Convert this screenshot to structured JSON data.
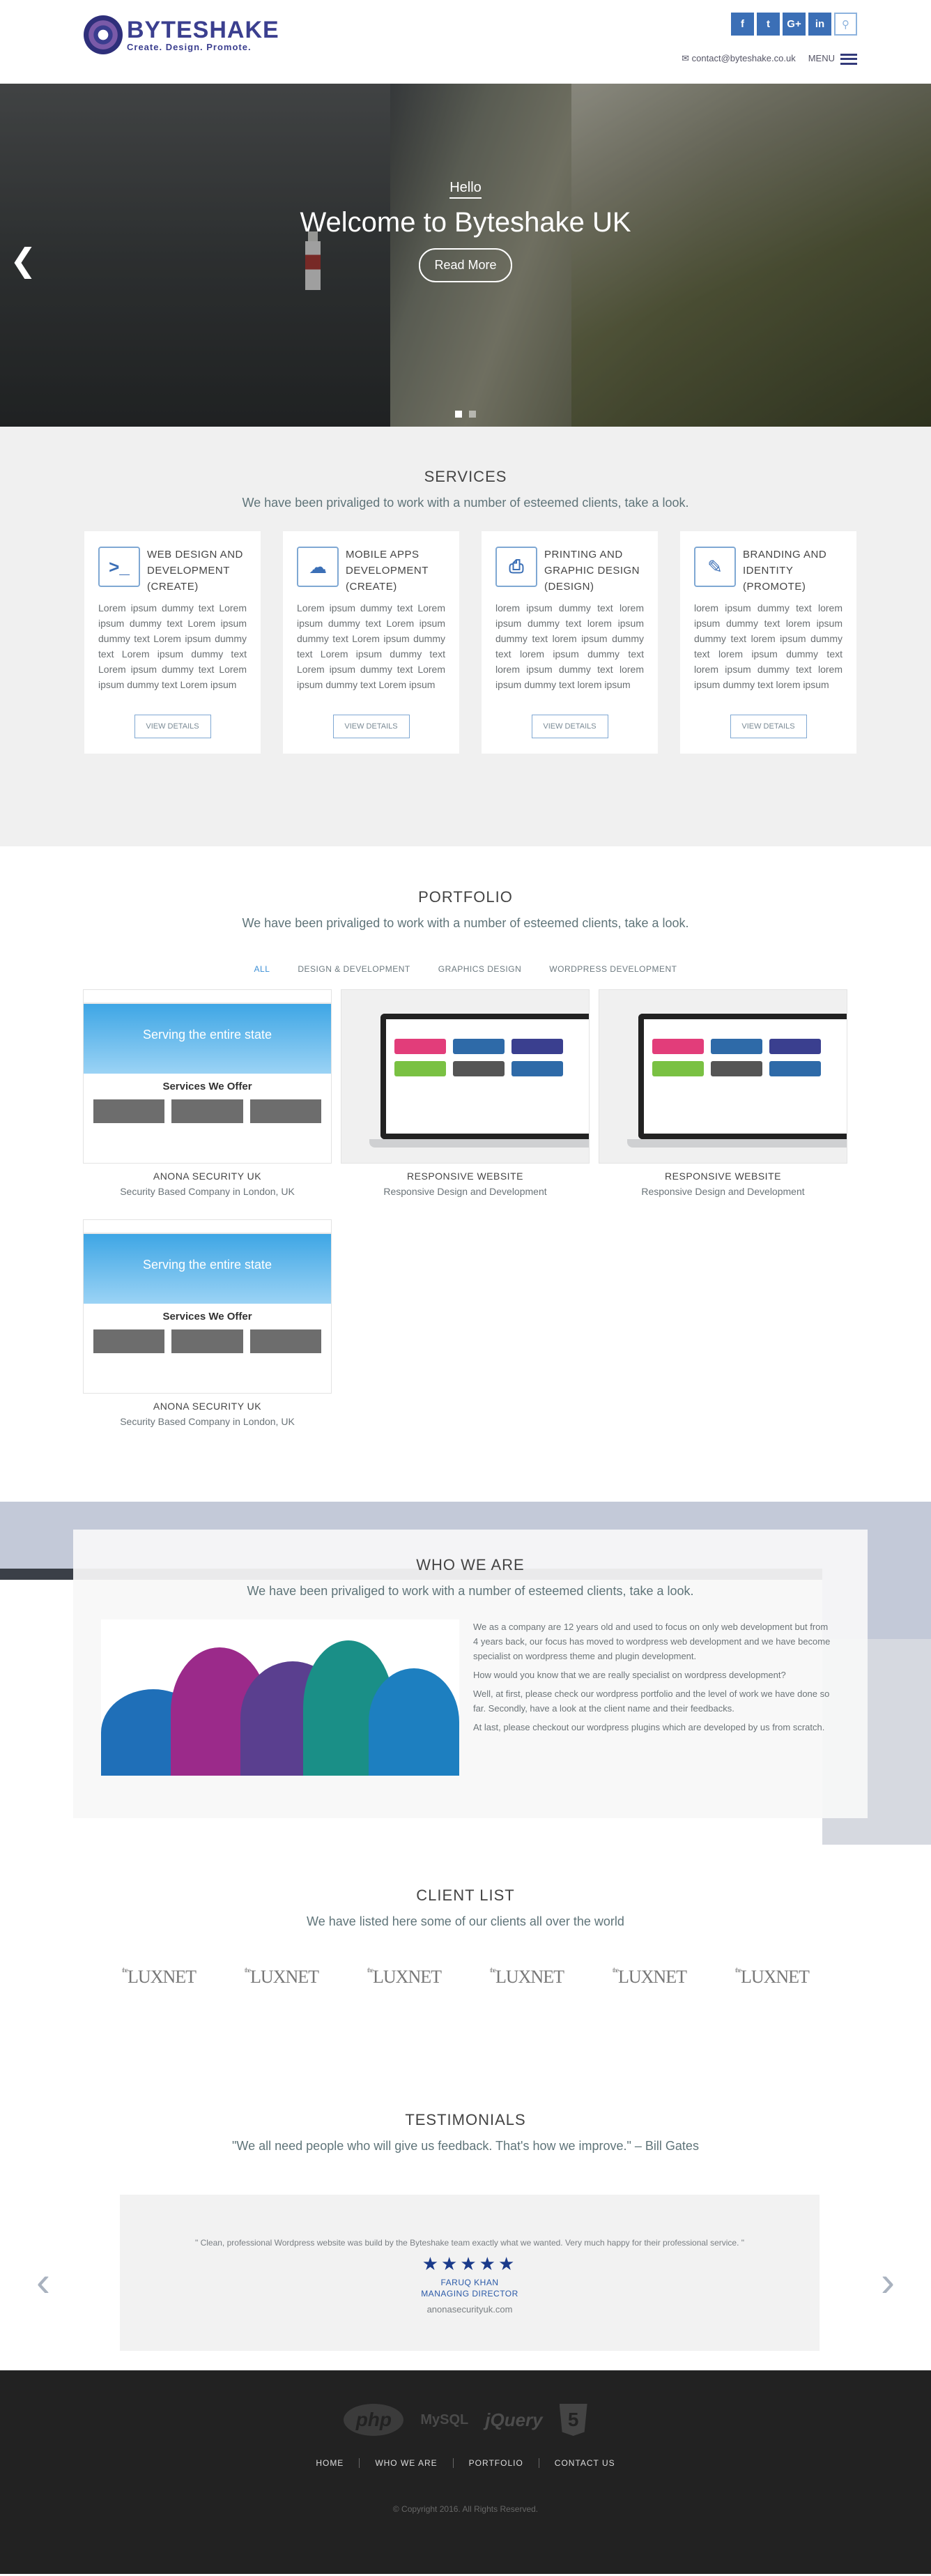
{
  "header": {
    "logo_name": "BYTESHAKE",
    "logo_tag": "Create.  Design.  Promote.",
    "social": [
      "f",
      "t",
      "G+",
      "in"
    ],
    "email": "contact@byteshake.co.uk",
    "menu_label": "MENU"
  },
  "hero": {
    "hello": "Hello",
    "title": "Welcome to Byteshake UK",
    "button": "Read More"
  },
  "services": {
    "title": "SERVICES",
    "subtitle": "We have been privaliged to work with a number of esteemed clients, take a look.",
    "items": [
      {
        "title": "WEB DESIGN AND DEVELOPMENT (CREATE)",
        "text": "Lorem ipsum dummy text Lorem ipsum dummy text Lorem ipsum dummy text Lorem ipsum dummy text Lorem ipsum dummy text Lorem ipsum dummy text Lorem ipsum dummy text Lorem ipsum",
        "button": "VIEW DETAILS",
        "icon": "browser-icon"
      },
      {
        "title": "MOBILE APPS DEVELOPMENT (CREATE)",
        "text": "Lorem ipsum dummy text Lorem ipsum dummy text Lorem ipsum dummy text Lorem ipsum dummy text Lorem ipsum dummy text Lorem ipsum dummy text Lorem ipsum dummy text Lorem ipsum",
        "button": "VIEW DETAILS",
        "icon": "cloud-icon"
      },
      {
        "title": "PRINTING AND GRAPHIC DESIGN (DESIGN)",
        "text": "lorem ipsum dummy text lorem ipsum dummy text lorem ipsum dummy text lorem ipsum dummy text lorem ipsum dummy text lorem ipsum dummy text lorem ipsum dummy text lorem ipsum",
        "button": "VIEW DETAILS",
        "icon": "printer-icon"
      },
      {
        "title": "BRANDING AND IDENTITY (PROMOTE)",
        "text": "lorem ipsum dummy text lorem ipsum dummy text lorem ipsum dummy text lorem ipsum dummy text lorem ipsum dummy text lorem ipsum dummy text lorem ipsum dummy text lorem ipsum",
        "button": "VIEW DETAILS",
        "icon": "pencil-icon"
      }
    ]
  },
  "portfolio": {
    "title": "PORTFOLIO",
    "subtitle": "We have been privaliged to work with a number of esteemed clients, take a look.",
    "tabs": [
      "ALL",
      "DESIGN & DEVELOPMENT",
      "GRAPHICS DESIGN",
      "WORDPRESS DEVELOPMENT"
    ],
    "items": [
      {
        "name": "ANONA SECURITY UK",
        "desc": "Security Based Company in London, UK",
        "banner": "Serving the entire state",
        "mid": "Services We Offer"
      },
      {
        "name": "RESPONSIVE WEBSITE",
        "desc": "Responsive Design and Development"
      },
      {
        "name": "RESPONSIVE WEBSITE",
        "desc": "Responsive Design and Development"
      },
      {
        "name": "ANONA SECURITY UK",
        "desc": "Security Based Company in London, UK",
        "banner": "Serving the entire state",
        "mid": "Services We Offer"
      }
    ]
  },
  "who": {
    "title": "WHO WE ARE",
    "subtitle": "We have been privaliged to work with a number of esteemed clients, take a look.",
    "p1": "We as a company are 12 years old and used to focus on only web development but from 4 years back, our focus has moved to wordpress web development and we have become specialist on wordpress theme and plugin development.",
    "p2": "How would you know that we are really specialist on wordpress development?",
    "p3": "Well, at first, please check our wordpress portfolio and the level of work we have done so far. Secondly, have a look at the client name and their feedbacks.",
    "p4": "At last, please checkout our wordpress plugins which are developed by us from scratch."
  },
  "clients": {
    "title": "CLIENT LIST",
    "subtitle": "We have listed here some of our clients all over the world",
    "logos": [
      "LUXNET",
      "LUXNET",
      "LUXNET",
      "LUXNET",
      "LUXNET",
      "LUXNET"
    ],
    "logo_prefix": "the"
  },
  "testimonials": {
    "title": "TESTIMONIALS",
    "subtitle": "\"We all need people who will give us feedback. That's how we improve.\" – Bill Gates",
    "quote": "\" Clean, professional Wordpress website was build by the Byteshake team exactly what we wanted. Very much happy for their professional service. \"",
    "stars": "★★★★★",
    "rating": 5,
    "name": "FARUQ KHAN",
    "role": "MANAGING DIRECTOR",
    "site": "anonasecurityuk.com"
  },
  "footer": {
    "tech": [
      "php",
      "MySQL",
      "jQuery",
      "5"
    ],
    "nav": [
      "HOME",
      "WHO WE ARE",
      "PORTFOLIO",
      "CONTACT US"
    ],
    "copyright": "© Copyright 2016. All Rights Reserved."
  },
  "colors": {
    "accent": "#3b6fb6",
    "brand": "#3b3f8f",
    "footer": "#222222",
    "section_bg": "#f0f0f0"
  }
}
